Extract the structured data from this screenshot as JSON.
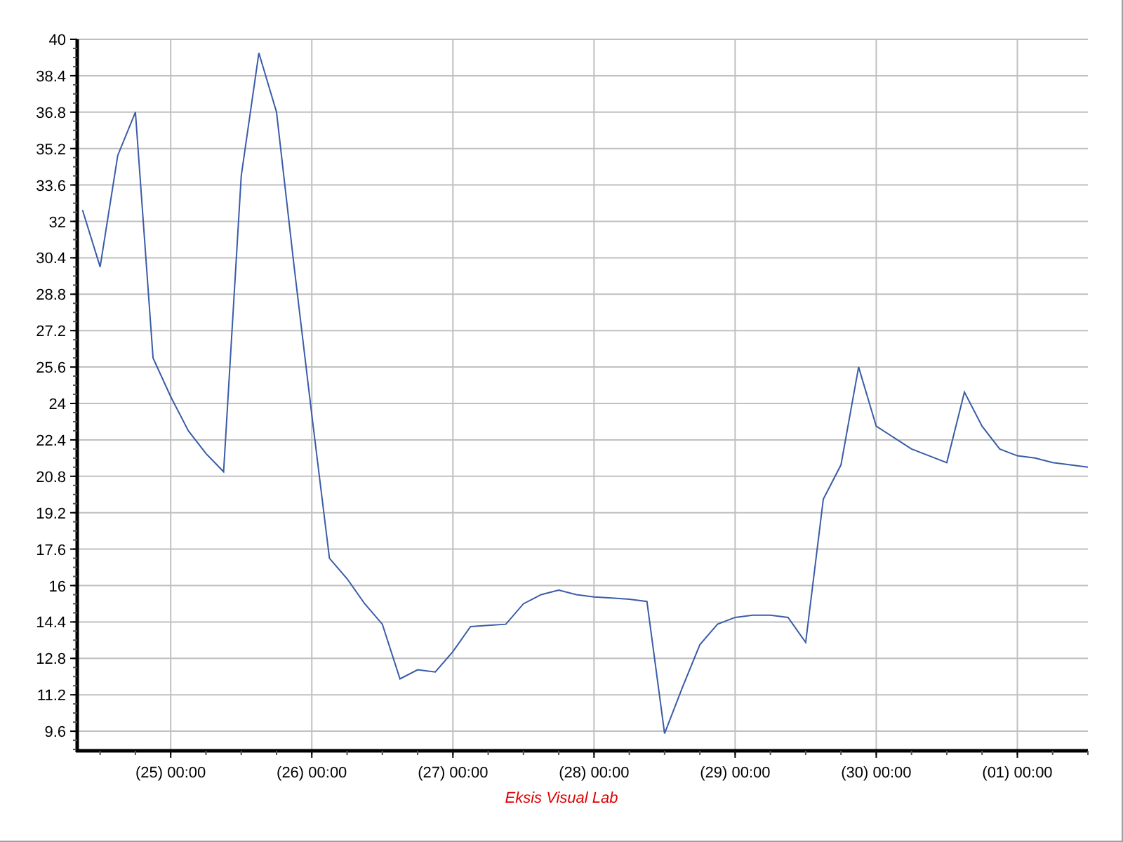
{
  "chart": {
    "chart_data": {
      "type": "line",
      "grid": true,
      "categories": [
        null,
        null,
        null,
        null,
        null,
        "(25) 00:00",
        null,
        null,
        null,
        null,
        null,
        null,
        null,
        "(26) 00:00",
        null,
        null,
        null,
        null,
        null,
        null,
        null,
        "(27) 00:00",
        null,
        null,
        null,
        null,
        null,
        null,
        null,
        "(28) 00:00",
        null,
        null,
        null,
        null,
        null,
        null,
        null,
        "(29) 00:00",
        null,
        null,
        null,
        null,
        null,
        null,
        null,
        "(30) 00:00",
        null,
        null,
        null,
        null,
        null,
        null,
        null,
        "(01) 00:00",
        null,
        null,
        null,
        null
      ],
      "series": [
        {
          "color": "#3a5ca8",
          "values": [
            32.5,
            30.0,
            34.9,
            36.8,
            26.0,
            24.3,
            22.8,
            21.8,
            21.0,
            34.0,
            39.4,
            36.8,
            30.0,
            23.5,
            17.2,
            16.3,
            15.2,
            14.3,
            11.9,
            12.3,
            12.2,
            13.1,
            14.2,
            14.25,
            14.3,
            15.2,
            15.6,
            15.8,
            15.6,
            15.5,
            15.45,
            15.4,
            15.3,
            9.5,
            11.5,
            13.4,
            14.3,
            14.6,
            14.7,
            14.7,
            14.6,
            13.5,
            19.8,
            21.3,
            25.6,
            23.0,
            22.5,
            22.0,
            21.7,
            21.4,
            24.5,
            23.0,
            22.0,
            21.7,
            21.6,
            21.4,
            21.3,
            21.2
          ]
        }
      ],
      "ylim": [
        8.74,
        40
      ],
      "yticks": [
        9.6,
        11.2,
        12.8,
        14.4,
        16,
        17.6,
        19.2,
        20.8,
        22.4,
        24,
        25.6,
        27.2,
        28.8,
        30.4,
        32,
        33.6,
        35.2,
        36.8,
        38.4,
        40
      ]
    },
    "credit": "Eksis Visual Lab"
  }
}
